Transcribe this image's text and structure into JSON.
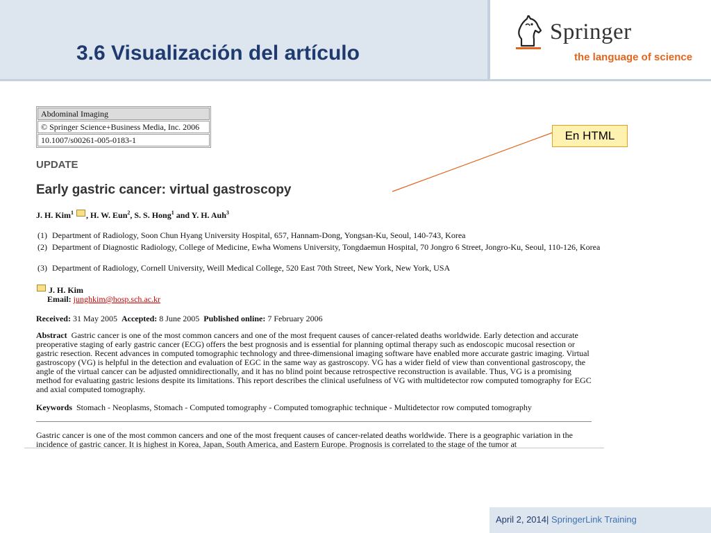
{
  "slide": {
    "title": "3.6 Visualización del artículo"
  },
  "logo": {
    "name": "Springer",
    "tagline": "the language of science",
    "tagline_color": "#e3641c"
  },
  "article": {
    "meta": [
      "Abdominal Imaging",
      "© Springer Science+Business Media, Inc. 2006",
      "10.1007/s00261-005-0183-1"
    ],
    "section": "UPDATE",
    "title": "Early gastric cancer: virtual gastroscopy",
    "authors": [
      {
        "name": "J. H. Kim",
        "sup": "1",
        "envelope": true,
        "sep": ", "
      },
      {
        "name": "H. W. Eun",
        "sup": "2",
        "envelope": false,
        "sep": ", "
      },
      {
        "name": "S. S. Hong",
        "sup": "1",
        "envelope": false,
        "sep": " and "
      },
      {
        "name": "Y. H. Auh",
        "sup": "3",
        "envelope": false,
        "sep": ""
      }
    ],
    "affiliations": [
      {
        "num": "(1)",
        "text": "Department of Radiology, Soon Chun Hyang University Hospital, 657, Hannam-Dong, Yongsan-Ku, Seoul, 140-743, Korea"
      },
      {
        "num": "(2)",
        "text": "Department of Diagnostic Radiology, College of Medicine, Ewha Womens University, Tongdaemun Hospital, 70 Jongro 6 Street, Jongro-Ku, Seoul, 110-126, Korea"
      },
      {
        "num": "(3)",
        "text": "Department of Radiology, Cornell University, Weill Medical College, 520 East 70th Street, New York, New York, USA"
      }
    ],
    "contact": {
      "name": "J. H. Kim",
      "email_label": "Email:",
      "email": "junghkim@hosp.sch.ac.kr"
    },
    "dates": {
      "received_label": "Received:",
      "received": "31 May 2005",
      "accepted_label": "Accepted:",
      "accepted": "8 June 2005",
      "published_label": "Published online:",
      "published": "7 February 2006"
    },
    "abstract_label": "Abstract",
    "abstract": "Gastric cancer is one of the most common cancers and one of the most frequent causes of cancer-related deaths worldwide. Early detection and accurate preoperative staging of early gastric cancer (ECG) offers the best prognosis and is essential for planning optimal therapy such as endoscopic mucosal resection or gastric resection. Recent advances in computed tomographic technology and three-dimensional imaging software have enabled more accurate gastric imaging. Virtual gastroscopy (VG) is helpful in the detection and evaluation of EGC in the same way as gastroscopy. VG has a wider field of view than conventional gastroscopy, the angle of the virtual cancer can be adjusted omnidirectionally, and it has no blind point because retrospective reconstruction is available. Thus, VG is a promising method for evaluating gastric lesions despite its limitations. This report describes the clinical usefulness of VG with multidetector row computed tomography for EGC and axial computed tomography.",
    "keywords_label": "Keywords",
    "keywords": "Stomach - Neoplasms, Stomach - Computed tomography - Computed tomographic technique - Multidetector row computed tomography",
    "body": "Gastric cancer is one of the most common cancers and one of the most frequent causes of cancer-related deaths worldwide. There is a geographic variation in the incidence of gastric cancer. It is highest in Korea, Japan, South America, and Eastern Europe. Prognosis is correlated to the stage of the tumor at"
  },
  "callout": {
    "label": "En HTML",
    "line_color": "#e3641c"
  },
  "footer": {
    "date": "April 2, 2014",
    "separator": "|",
    "course": " SpringerLink Training"
  }
}
